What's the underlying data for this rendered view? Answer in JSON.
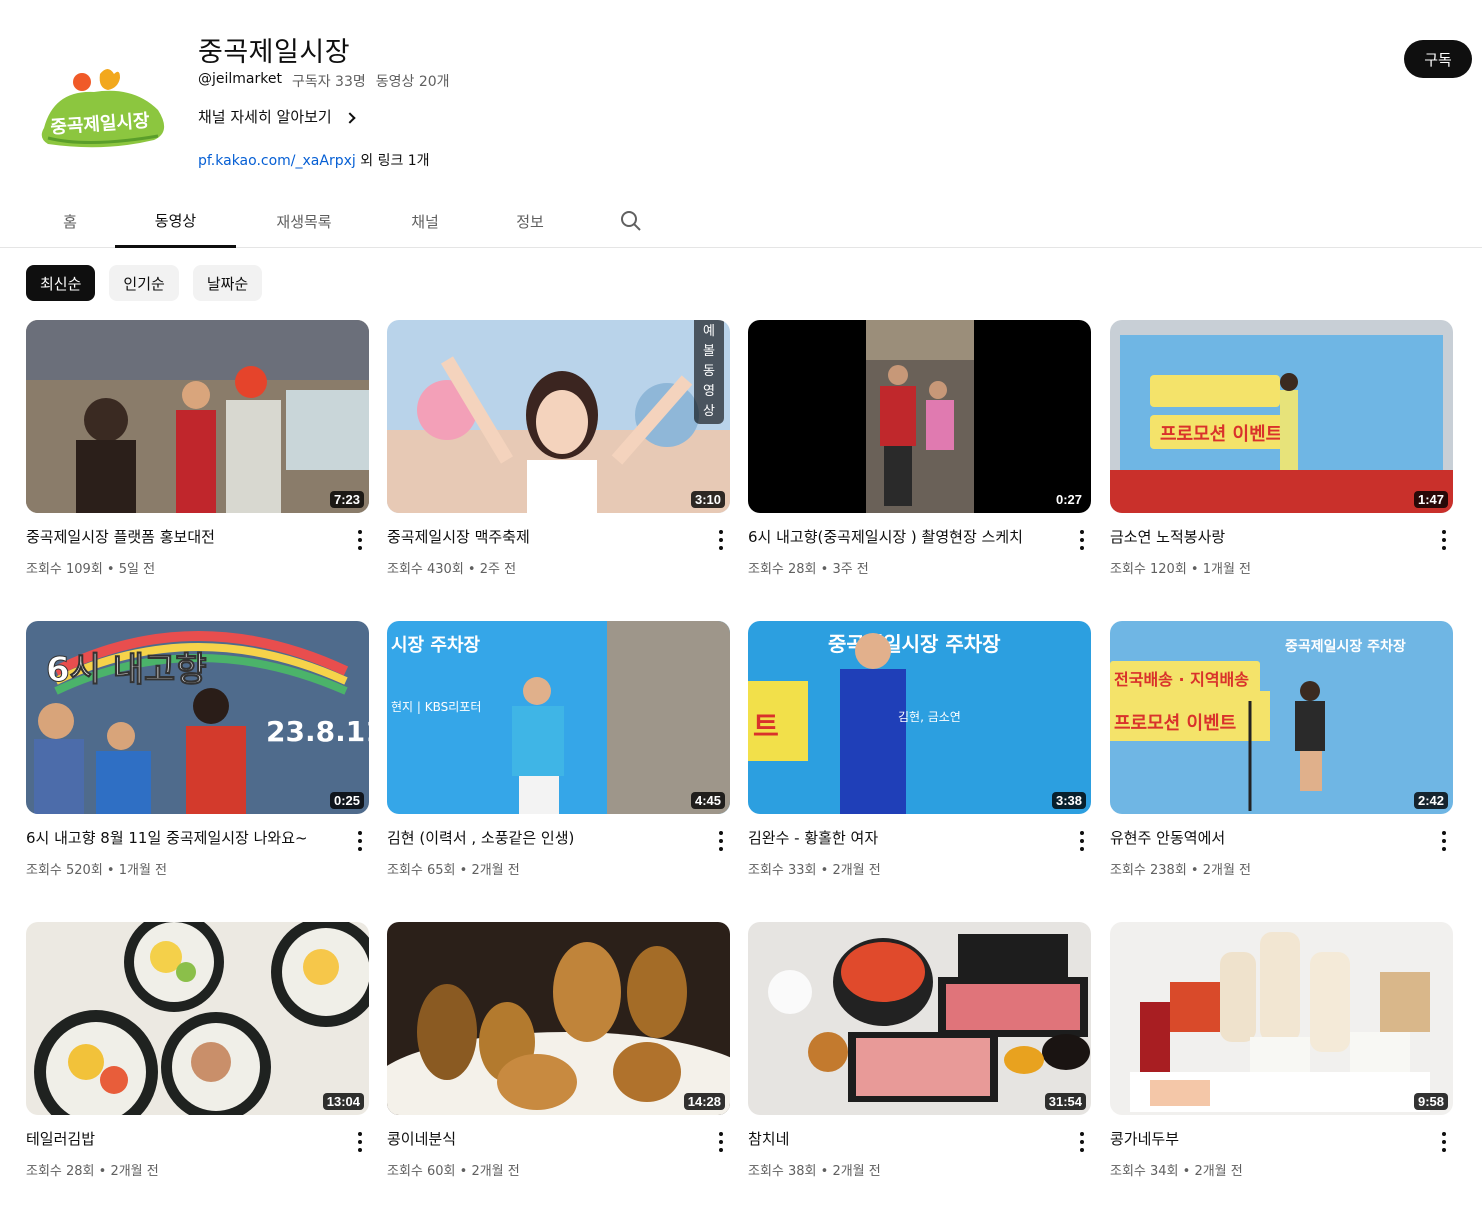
{
  "channel": {
    "title": "중곡제일시장",
    "handle": "@jeilmarket",
    "subscribers": "구독자 33명",
    "video_count": "동영상 20개",
    "more_label": "채널 자세히 알아보기",
    "link_text": "pf.kakao.com/_xaArpxj",
    "link_extra": "외 링크 1개",
    "subscribe_label": "구독",
    "logo_text": "중곡제일시장"
  },
  "tabs": [
    "홈",
    "동영상",
    "재생목록",
    "채널",
    "정보"
  ],
  "active_tab": "동영상",
  "chips": [
    "최신순",
    "인기순",
    "날짜순"
  ],
  "active_chip": "최신순",
  "videos": [
    {
      "title": "중곡제일시장 플랫폼 홍보대전",
      "meta": "조회수 109회 • 5일 전",
      "duration": "7:23",
      "theme": "market"
    },
    {
      "title": "중곡제일시장 맥주축제",
      "meta": "조회수 430회 • 2주 전",
      "duration": "3:10",
      "theme": "dance",
      "vertical_label": "예볼동영상"
    },
    {
      "title": "6시 내고향(중곡제일시장 ) 촬영현장 스케치",
      "meta": "조회수 28회 • 3주 전",
      "duration": "0:27",
      "theme": "vertical"
    },
    {
      "title": "금소연 노적봉사랑",
      "meta": "조회수 120회 • 1개월 전",
      "duration": "1:47",
      "theme": "stage"
    },
    {
      "title": "6시 내고향 8월 11일 중곡제일시장 나와요~",
      "meta": "조회수 520회 • 1개월 전",
      "duration": "0:25",
      "theme": "tv"
    },
    {
      "title": "김현 (이력서 , 소풍같은 인생)",
      "meta": "조회수 65회 • 2개월 전",
      "duration": "4:45",
      "theme": "singer-blue"
    },
    {
      "title": "김완수 - 황홀한 여자",
      "meta": "조회수 33회 • 2개월 전",
      "duration": "3:38",
      "theme": "singer-navy"
    },
    {
      "title": "유현주 안동역에서",
      "meta": "조회수 238회 • 2개월 전",
      "duration": "2:42",
      "theme": "accordion"
    },
    {
      "title": "테일러김밥",
      "meta": "조회수 28회 • 2개월 전",
      "duration": "13:04",
      "theme": "kimbap"
    },
    {
      "title": "콩이네분식",
      "meta": "조회수 60회 • 2개월 전",
      "duration": "14:28",
      "theme": "fried"
    },
    {
      "title": "참치네",
      "meta": "조회수 38회 • 2개월 전",
      "duration": "31:54",
      "theme": "tuna"
    },
    {
      "title": "콩가네두부",
      "meta": "조회수 34회 • 2개월 전",
      "duration": "9:58",
      "theme": "tofu"
    }
  ]
}
